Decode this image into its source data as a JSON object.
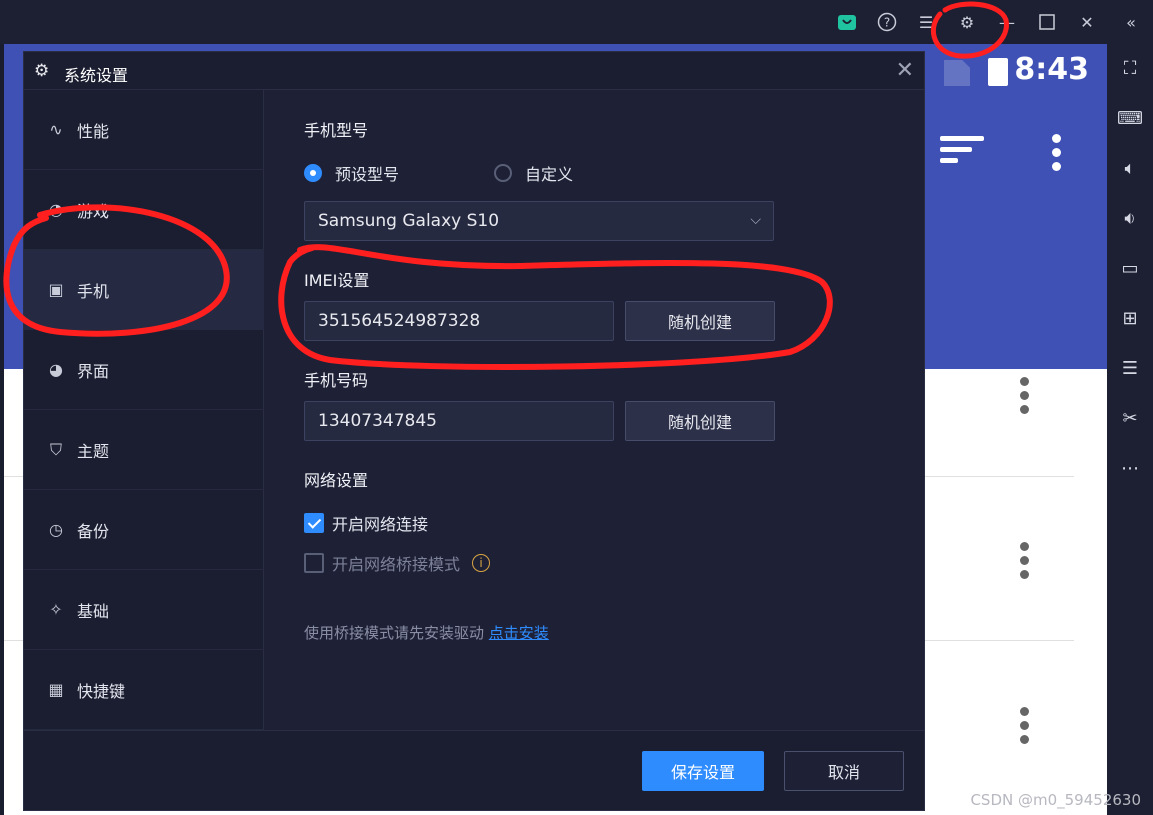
{
  "emulator": {
    "status_time": "8:43",
    "toolbar_icons": [
      "store-icon",
      "help-icon",
      "menu-icon",
      "settings-icon",
      "minimize-icon",
      "maximize-icon",
      "close-icon",
      "collapse-icon"
    ],
    "sidebar_icons": [
      "fullscreen-icon",
      "keyboard-icon",
      "volume-up-icon",
      "volume-down-icon",
      "screen-icon",
      "apk-install-icon",
      "multi-instance-icon",
      "screenshot-scissors-icon",
      "more-icon"
    ]
  },
  "dialog": {
    "title": "系统设置",
    "nav": [
      {
        "label": "性能",
        "icon": "pulse-icon"
      },
      {
        "label": "游戏",
        "icon": "gauge-icon"
      },
      {
        "label": "手机",
        "icon": "phone-icon"
      },
      {
        "label": "界面",
        "icon": "palette-icon"
      },
      {
        "label": "主题",
        "icon": "shirt-icon"
      },
      {
        "label": "备份",
        "icon": "history-icon"
      },
      {
        "label": "基础",
        "icon": "puzzle-icon"
      },
      {
        "label": "快捷键",
        "icon": "keyboard-icon"
      }
    ],
    "active_nav": "手机",
    "phone_model": {
      "label": "手机型号",
      "option_preset": "预设型号",
      "option_custom": "自定义",
      "selected_option": "预设型号",
      "selected_model": "Samsung Galaxy S10"
    },
    "imei": {
      "label": "IMEI设置",
      "value": "351564524987328",
      "button": "随机创建"
    },
    "phone_number": {
      "label": "手机号码",
      "value": "13407347845",
      "button": "随机创建"
    },
    "network": {
      "label": "网络设置",
      "enable_network": {
        "label": "开启网络连接",
        "checked": true
      },
      "bridge_mode": {
        "label": "开启网络桥接模式",
        "checked": false
      },
      "hint": "使用桥接模式请先安装驱动",
      "hint_link": "点击安装"
    },
    "footer": {
      "save": "保存设置",
      "cancel": "取消"
    }
  },
  "watermark": "CSDN @m0_59452630",
  "colors": {
    "accent": "#2f8cff",
    "dialog_bg": "#1e2136",
    "android_appbar": "#3f51b5",
    "annotation": "#ff1f1f"
  }
}
